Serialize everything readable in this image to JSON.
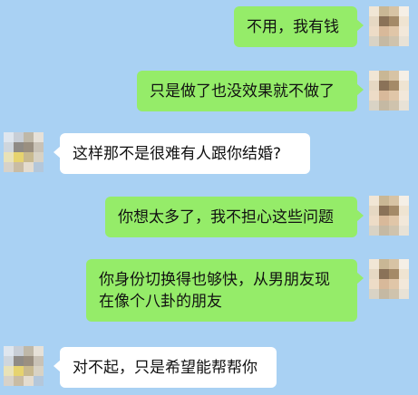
{
  "messages": [
    {
      "side": "right",
      "text": "不用，我有钱"
    },
    {
      "side": "right",
      "text": "只是做了也没效果就不做了"
    },
    {
      "side": "left",
      "text": "这样那不是很难有人跟你结婚?"
    },
    {
      "side": "right",
      "text": "你想太多了，我不担心这些问题"
    },
    {
      "side": "right",
      "text": "你身份切换得也够快，从男朋友现\n在像个八卦的朋友"
    },
    {
      "side": "left",
      "text": "对不起，只是希望能帮帮你"
    }
  ],
  "colors": {
    "background": "#a9d1f3",
    "outgoing_bubble": "#95ec69",
    "incoming_bubble": "#ffffff"
  },
  "avatars": {
    "right_icon": "pixelated-avatar-icon",
    "left_icon": "pixelated-avatar-icon"
  }
}
